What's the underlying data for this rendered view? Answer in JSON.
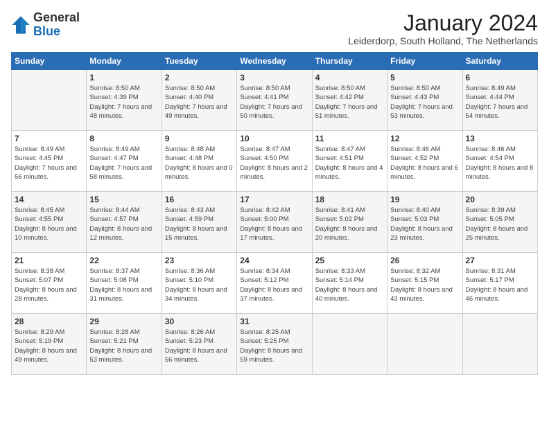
{
  "logo": {
    "general": "General",
    "blue": "Blue"
  },
  "title": "January 2024",
  "location": "Leiderdorp, South Holland, The Netherlands",
  "days_of_week": [
    "Sunday",
    "Monday",
    "Tuesday",
    "Wednesday",
    "Thursday",
    "Friday",
    "Saturday"
  ],
  "weeks": [
    [
      {
        "day": "",
        "sunrise": "",
        "sunset": "",
        "daylight": ""
      },
      {
        "day": "1",
        "sunrise": "Sunrise: 8:50 AM",
        "sunset": "Sunset: 4:39 PM",
        "daylight": "Daylight: 7 hours and 48 minutes."
      },
      {
        "day": "2",
        "sunrise": "Sunrise: 8:50 AM",
        "sunset": "Sunset: 4:40 PM",
        "daylight": "Daylight: 7 hours and 49 minutes."
      },
      {
        "day": "3",
        "sunrise": "Sunrise: 8:50 AM",
        "sunset": "Sunset: 4:41 PM",
        "daylight": "Daylight: 7 hours and 50 minutes."
      },
      {
        "day": "4",
        "sunrise": "Sunrise: 8:50 AM",
        "sunset": "Sunset: 4:42 PM",
        "daylight": "Daylight: 7 hours and 51 minutes."
      },
      {
        "day": "5",
        "sunrise": "Sunrise: 8:50 AM",
        "sunset": "Sunset: 4:43 PM",
        "daylight": "Daylight: 7 hours and 53 minutes."
      },
      {
        "day": "6",
        "sunrise": "Sunrise: 8:49 AM",
        "sunset": "Sunset: 4:44 PM",
        "daylight": "Daylight: 7 hours and 54 minutes."
      }
    ],
    [
      {
        "day": "7",
        "sunrise": "Sunrise: 8:49 AM",
        "sunset": "Sunset: 4:45 PM",
        "daylight": "Daylight: 7 hours and 56 minutes."
      },
      {
        "day": "8",
        "sunrise": "Sunrise: 8:49 AM",
        "sunset": "Sunset: 4:47 PM",
        "daylight": "Daylight: 7 hours and 58 minutes."
      },
      {
        "day": "9",
        "sunrise": "Sunrise: 8:48 AM",
        "sunset": "Sunset: 4:48 PM",
        "daylight": "Daylight: 8 hours and 0 minutes."
      },
      {
        "day": "10",
        "sunrise": "Sunrise: 8:47 AM",
        "sunset": "Sunset: 4:50 PM",
        "daylight": "Daylight: 8 hours and 2 minutes."
      },
      {
        "day": "11",
        "sunrise": "Sunrise: 8:47 AM",
        "sunset": "Sunset: 4:51 PM",
        "daylight": "Daylight: 8 hours and 4 minutes."
      },
      {
        "day": "12",
        "sunrise": "Sunrise: 8:46 AM",
        "sunset": "Sunset: 4:52 PM",
        "daylight": "Daylight: 8 hours and 6 minutes."
      },
      {
        "day": "13",
        "sunrise": "Sunrise: 8:46 AM",
        "sunset": "Sunset: 4:54 PM",
        "daylight": "Daylight: 8 hours and 8 minutes."
      }
    ],
    [
      {
        "day": "14",
        "sunrise": "Sunrise: 8:45 AM",
        "sunset": "Sunset: 4:55 PM",
        "daylight": "Daylight: 8 hours and 10 minutes."
      },
      {
        "day": "15",
        "sunrise": "Sunrise: 8:44 AM",
        "sunset": "Sunset: 4:57 PM",
        "daylight": "Daylight: 8 hours and 12 minutes."
      },
      {
        "day": "16",
        "sunrise": "Sunrise: 8:43 AM",
        "sunset": "Sunset: 4:59 PM",
        "daylight": "Daylight: 8 hours and 15 minutes."
      },
      {
        "day": "17",
        "sunrise": "Sunrise: 8:42 AM",
        "sunset": "Sunset: 5:00 PM",
        "daylight": "Daylight: 8 hours and 17 minutes."
      },
      {
        "day": "18",
        "sunrise": "Sunrise: 8:41 AM",
        "sunset": "Sunset: 5:02 PM",
        "daylight": "Daylight: 8 hours and 20 minutes."
      },
      {
        "day": "19",
        "sunrise": "Sunrise: 8:40 AM",
        "sunset": "Sunset: 5:03 PM",
        "daylight": "Daylight: 8 hours and 23 minutes."
      },
      {
        "day": "20",
        "sunrise": "Sunrise: 8:39 AM",
        "sunset": "Sunset: 5:05 PM",
        "daylight": "Daylight: 8 hours and 25 minutes."
      }
    ],
    [
      {
        "day": "21",
        "sunrise": "Sunrise: 8:38 AM",
        "sunset": "Sunset: 5:07 PM",
        "daylight": "Daylight: 8 hours and 28 minutes."
      },
      {
        "day": "22",
        "sunrise": "Sunrise: 8:37 AM",
        "sunset": "Sunset: 5:08 PM",
        "daylight": "Daylight: 8 hours and 31 minutes."
      },
      {
        "day": "23",
        "sunrise": "Sunrise: 8:36 AM",
        "sunset": "Sunset: 5:10 PM",
        "daylight": "Daylight: 8 hours and 34 minutes."
      },
      {
        "day": "24",
        "sunrise": "Sunrise: 8:34 AM",
        "sunset": "Sunset: 5:12 PM",
        "daylight": "Daylight: 8 hours and 37 minutes."
      },
      {
        "day": "25",
        "sunrise": "Sunrise: 8:33 AM",
        "sunset": "Sunset: 5:14 PM",
        "daylight": "Daylight: 8 hours and 40 minutes."
      },
      {
        "day": "26",
        "sunrise": "Sunrise: 8:32 AM",
        "sunset": "Sunset: 5:15 PM",
        "daylight": "Daylight: 8 hours and 43 minutes."
      },
      {
        "day": "27",
        "sunrise": "Sunrise: 8:31 AM",
        "sunset": "Sunset: 5:17 PM",
        "daylight": "Daylight: 8 hours and 46 minutes."
      }
    ],
    [
      {
        "day": "28",
        "sunrise": "Sunrise: 8:29 AM",
        "sunset": "Sunset: 5:19 PM",
        "daylight": "Daylight: 8 hours and 49 minutes."
      },
      {
        "day": "29",
        "sunrise": "Sunrise: 8:28 AM",
        "sunset": "Sunset: 5:21 PM",
        "daylight": "Daylight: 8 hours and 53 minutes."
      },
      {
        "day": "30",
        "sunrise": "Sunrise: 8:26 AM",
        "sunset": "Sunset: 5:23 PM",
        "daylight": "Daylight: 8 hours and 56 minutes."
      },
      {
        "day": "31",
        "sunrise": "Sunrise: 8:25 AM",
        "sunset": "Sunset: 5:25 PM",
        "daylight": "Daylight: 8 hours and 59 minutes."
      },
      {
        "day": "",
        "sunrise": "",
        "sunset": "",
        "daylight": ""
      },
      {
        "day": "",
        "sunrise": "",
        "sunset": "",
        "daylight": ""
      },
      {
        "day": "",
        "sunrise": "",
        "sunset": "",
        "daylight": ""
      }
    ]
  ]
}
